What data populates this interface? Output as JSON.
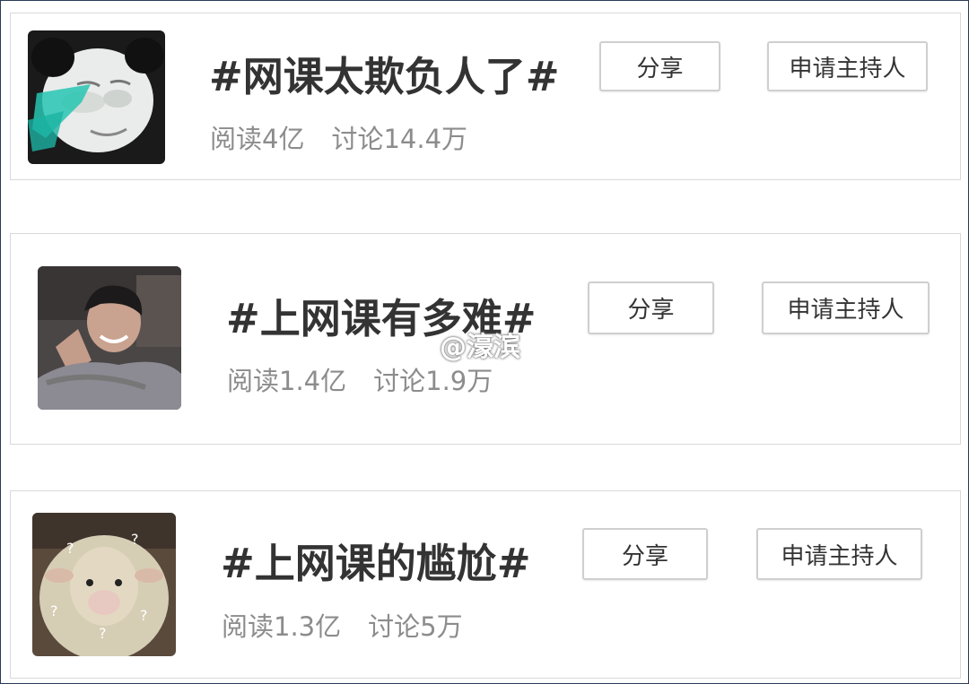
{
  "topics": [
    {
      "title": "#网课太欺负人了#",
      "reads": "阅读4亿",
      "discussions": "讨论14.4万",
      "share_label": "分享",
      "host_label": "申请主持人",
      "thumb_icon": "panda-meme-face-image"
    },
    {
      "title": "#上网课有多难#",
      "reads": "阅读1.4亿",
      "discussions": "讨论1.9万",
      "share_label": "分享",
      "host_label": "申请主持人",
      "thumb_icon": "smiling-man-photo"
    },
    {
      "title": "#上网课的尴尬#",
      "reads": "阅读1.3亿",
      "discussions": "讨论5万",
      "share_label": "分享",
      "host_label": "申请主持人",
      "thumb_icon": "confused-sheep-photo"
    }
  ],
  "watermark": "@濠滨",
  "colors": {
    "title": "#333333",
    "meta": "#8c8c8c",
    "border": "#d9d9d9",
    "frame": "#2b3a55"
  }
}
